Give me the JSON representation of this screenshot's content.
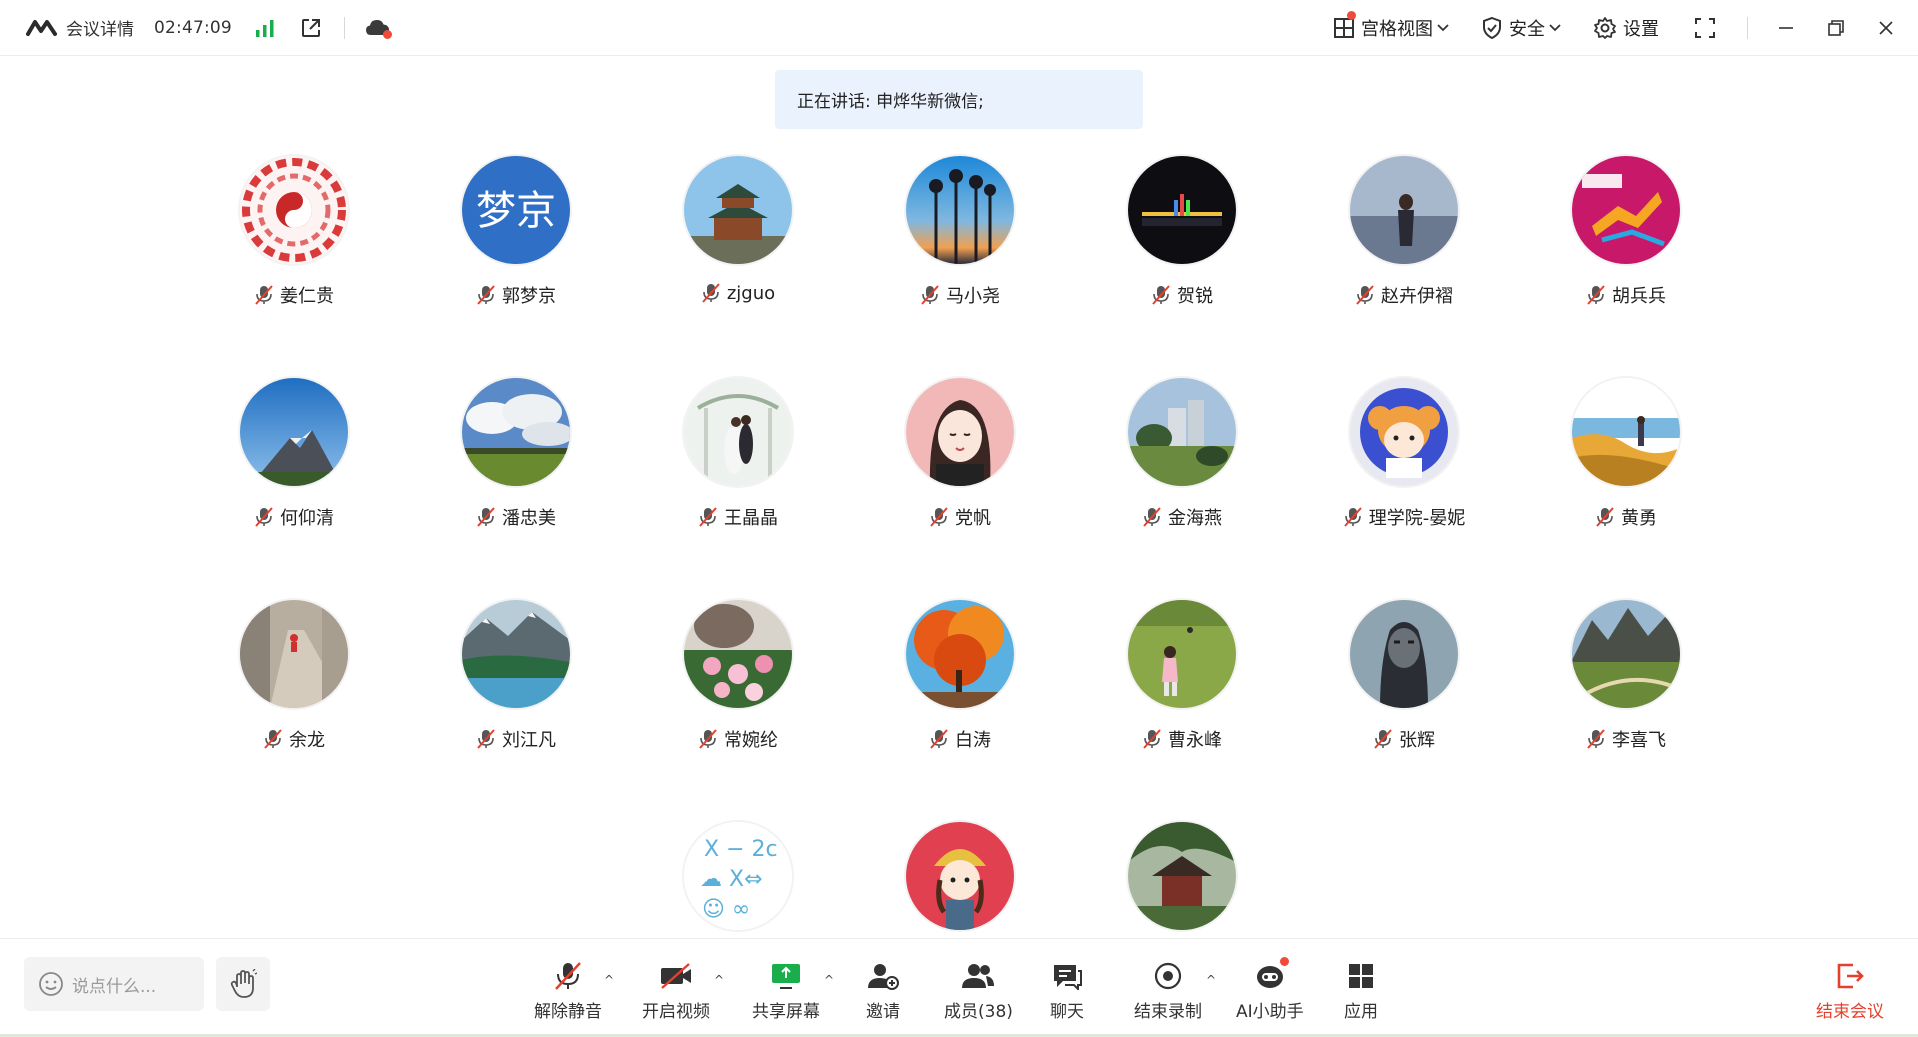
{
  "topbar": {
    "meeting_details": "会议详情",
    "timer": "02:47:09",
    "gallery_view": "宫格视图",
    "security": "安全",
    "settings": "设置"
  },
  "speaking": {
    "text": "正在讲话: 申烨华新微信;"
  },
  "participants": [
    {
      "name": "姜仁贵"
    },
    {
      "name": "郭梦京",
      "avatar_text": "梦京"
    },
    {
      "name": "zjguo"
    },
    {
      "name": "马小尧"
    },
    {
      "name": "贺锐"
    },
    {
      "name": "赵卉伊褶"
    },
    {
      "name": "胡兵兵"
    },
    {
      "name": "何仰清"
    },
    {
      "name": "潘忠美"
    },
    {
      "name": "王晶晶"
    },
    {
      "name": "党帆"
    },
    {
      "name": "金海燕"
    },
    {
      "name": "理学院-晏妮"
    },
    {
      "name": "黄勇"
    },
    {
      "name": "余龙"
    },
    {
      "name": "刘江凡"
    },
    {
      "name": "常婉纶"
    },
    {
      "name": "白涛"
    },
    {
      "name": "曹永峰"
    },
    {
      "name": "张辉"
    },
    {
      "name": "李喜飞"
    },
    {
      "name": ""
    },
    {
      "name": ""
    },
    {
      "name": ""
    }
  ],
  "bottombar": {
    "chat_placeholder": "说点什么...",
    "unmute": "解除静音",
    "start_video": "开启视频",
    "share_screen": "共享屏幕",
    "invite": "邀请",
    "members": "成员(38)",
    "chat": "聊天",
    "stop_recording": "结束录制",
    "ai_assistant": "AI小助手",
    "apps": "应用",
    "end_meeting": "结束会议"
  },
  "colors": {
    "accent_green": "#1aad4b",
    "end_red": "#e5402e",
    "banner_bg": "#eaf2fe"
  }
}
